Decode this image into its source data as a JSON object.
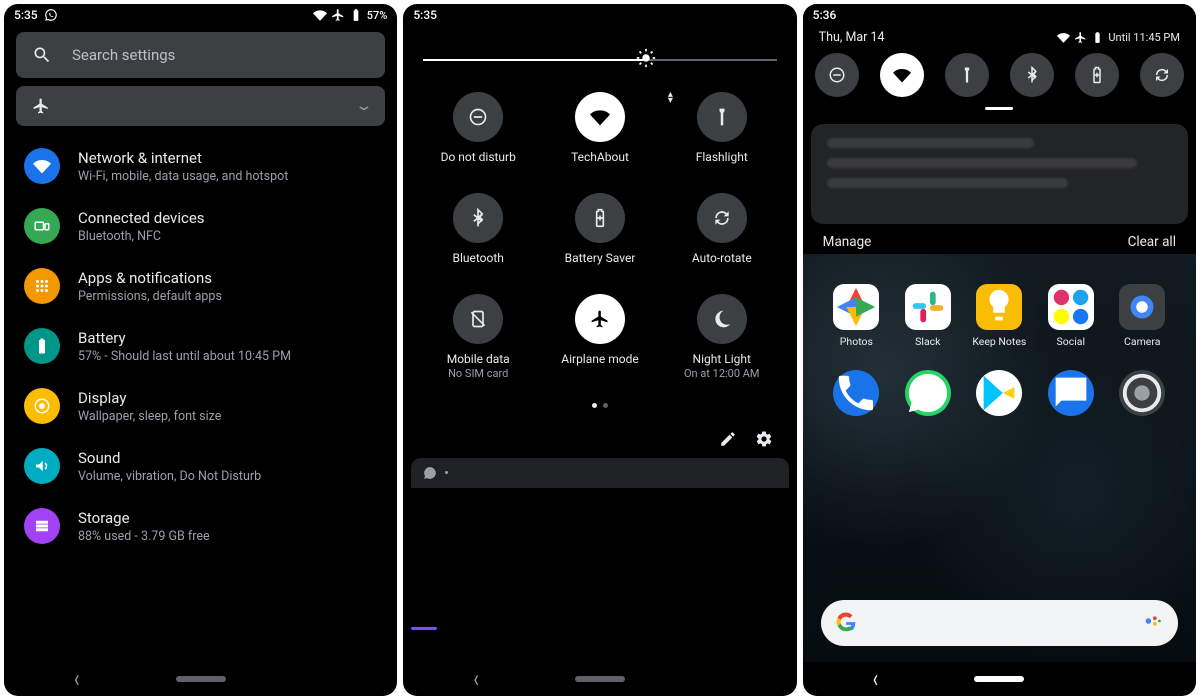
{
  "panel1": {
    "status": {
      "time": "5:35",
      "battery": "57%"
    },
    "search_placeholder": "Search settings",
    "settings": [
      {
        "key": "network",
        "title": "Network & internet",
        "sub": "Wi-Fi, mobile, data usage, and hotspot",
        "color": "#1a73e8"
      },
      {
        "key": "connected",
        "title": "Connected devices",
        "sub": "Bluetooth, NFC",
        "color": "#34a853"
      },
      {
        "key": "apps",
        "title": "Apps & notifications",
        "sub": "Permissions, default apps",
        "color": "#f29900"
      },
      {
        "key": "battery",
        "title": "Battery",
        "sub": "57% - Should last until about 10:45 PM",
        "color": "#009688"
      },
      {
        "key": "display",
        "title": "Display",
        "sub": "Wallpaper, sleep, font size",
        "color": "#fbbc04"
      },
      {
        "key": "sound",
        "title": "Sound",
        "sub": "Volume, vibration, Do Not Disturb",
        "color": "#00acc1"
      },
      {
        "key": "storage",
        "title": "Storage",
        "sub": "88% used - 3.79 GB free",
        "color": "#a142f4"
      }
    ]
  },
  "panel2": {
    "status": {
      "time": "5:35"
    },
    "brightness_pct": 63,
    "tiles": [
      {
        "key": "dnd",
        "label": "Do not disturb",
        "sub": "",
        "on": false,
        "icon": "dnd"
      },
      {
        "key": "wifi",
        "label": "TechAbout",
        "sub": "",
        "on": true,
        "icon": "wifi",
        "caret": true
      },
      {
        "key": "flash",
        "label": "Flashlight",
        "sub": "",
        "on": false,
        "icon": "flashlight"
      },
      {
        "key": "bt",
        "label": "Bluetooth",
        "sub": "",
        "on": false,
        "icon": "bluetooth"
      },
      {
        "key": "batt",
        "label": "Battery Saver",
        "sub": "",
        "on": false,
        "icon": "battery-saver"
      },
      {
        "key": "rotate",
        "label": "Auto-rotate",
        "sub": "",
        "on": false,
        "icon": "rotate"
      },
      {
        "key": "mobile",
        "label": "Mobile data",
        "sub": "No SIM card",
        "on": false,
        "icon": "sim-off",
        "dim": true
      },
      {
        "key": "airplane",
        "label": "Airplane mode",
        "sub": "",
        "on": true,
        "icon": "airplane"
      },
      {
        "key": "night",
        "label": "Night Light",
        "sub": "On at 12:00 AM",
        "on": false,
        "icon": "night"
      }
    ]
  },
  "panel3": {
    "status": {
      "time": "5:36"
    },
    "date": "Thu, Mar 14",
    "until": "Until 11:45 PM",
    "mini_tiles": [
      {
        "key": "dnd",
        "icon": "dnd",
        "on": false
      },
      {
        "key": "wifi",
        "icon": "wifi",
        "on": true
      },
      {
        "key": "flash",
        "icon": "flashlight",
        "on": false
      },
      {
        "key": "bt",
        "icon": "bluetooth",
        "on": false
      },
      {
        "key": "batt",
        "icon": "battery-saver",
        "on": false
      },
      {
        "key": "rotate",
        "icon": "rotate",
        "on": false
      }
    ],
    "manage_label": "Manage",
    "clear_label": "Clear all",
    "apps_row1": [
      {
        "key": "photos",
        "label": "Photos",
        "bg": "#fff"
      },
      {
        "key": "slack",
        "label": "Slack",
        "bg": "#fff"
      },
      {
        "key": "keep",
        "label": "Keep Notes",
        "bg": "#fbbc04"
      },
      {
        "key": "social",
        "label": "Social",
        "bg": "#fff"
      },
      {
        "key": "camera",
        "label": "Camera",
        "bg": "#3c4043"
      }
    ],
    "apps_row2": [
      {
        "key": "phone",
        "bg": "#1a73e8"
      },
      {
        "key": "whatsapp",
        "bg": "#25d366"
      },
      {
        "key": "play",
        "bg": "#fff"
      },
      {
        "key": "messages",
        "bg": "#1a73e8"
      },
      {
        "key": "settings",
        "bg": "#3c4043"
      }
    ]
  }
}
